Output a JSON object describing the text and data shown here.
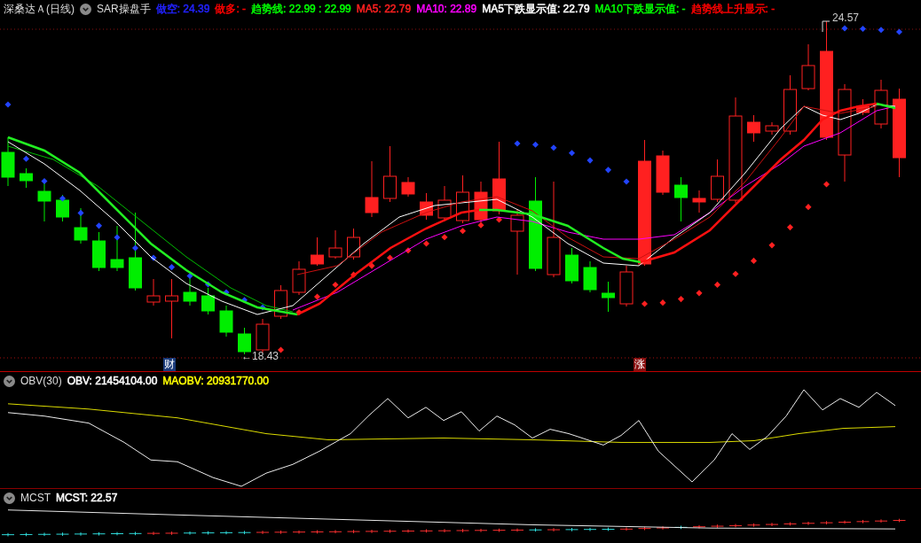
{
  "main_panel": {
    "title": "深桑达Ａ(日线)",
    "indicator": "SAR操盘手",
    "values": [
      {
        "text": "做空: 24.39",
        "color": "#2222ff"
      },
      {
        "text": "做多: -",
        "color": "#ff0000"
      },
      {
        "text": "趋势线: 22.99 : 22.99",
        "color": "#00ff00"
      },
      {
        "text": "MA5: 22.79",
        "color": "#ff2020"
      },
      {
        "text": "MA10: 22.89",
        "color": "#ff00ff"
      },
      {
        "text": "MA5下跌显示值: 22.79",
        "color": "#ffffff"
      },
      {
        "text": "MA10下跌显示值: -",
        "color": "#00ff00"
      },
      {
        "text": "趋势线上升显示: -",
        "color": "#ff0000"
      }
    ],
    "low_label": "←18.43",
    "high_label": "24.57",
    "markers": [
      {
        "text": "财",
        "color": "#1a3a7a"
      },
      {
        "text": "涨",
        "color": "#8a1010"
      }
    ]
  },
  "obv_panel": {
    "title": "OBV(30)",
    "values": [
      {
        "text": "OBV: 21454104.00",
        "color": "#ffffff"
      },
      {
        "text": "MAOBV: 20931770.00",
        "color": "#ffff00"
      }
    ]
  },
  "mcst_panel": {
    "title": "MCST",
    "values": [
      {
        "text": "MCST: 22.57",
        "color": "#ffffff"
      }
    ]
  }
}
